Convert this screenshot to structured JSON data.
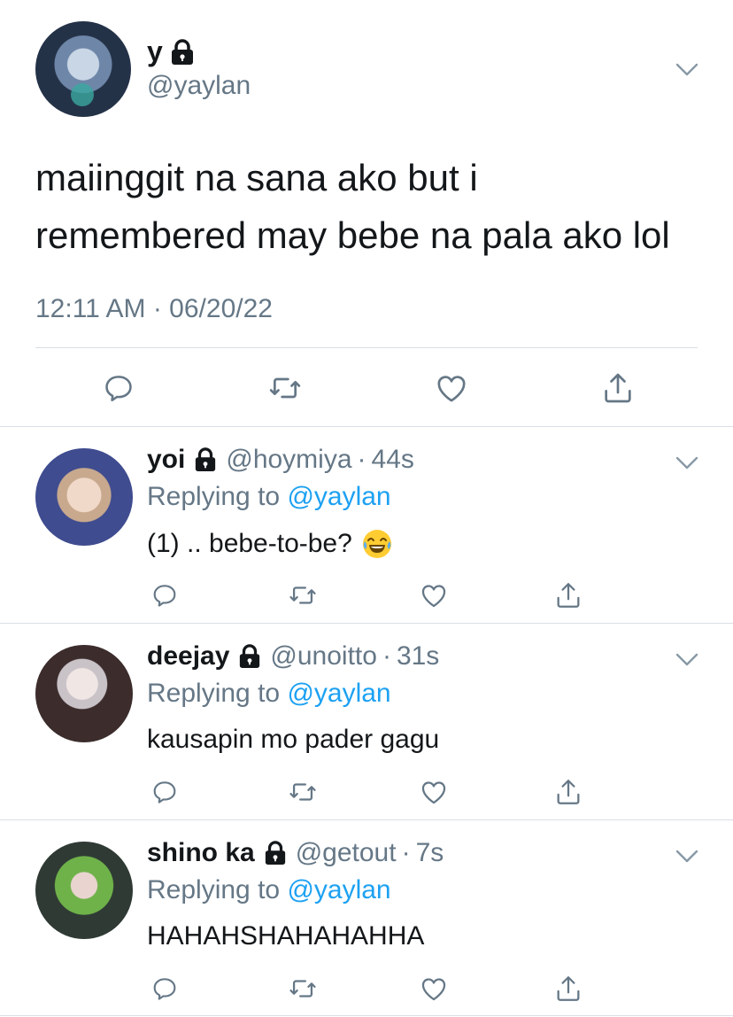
{
  "main_tweet": {
    "display_name": "y",
    "handle": "@yaylan",
    "text_line1": "maiinggit na sana ako but i",
    "text_line2": "remembered may bebe na pala ako lol",
    "timestamp": "12:11 AM · 06/20/22",
    "icons": [
      "lock-icon",
      "chevron-down-icon",
      "reply-icon",
      "retweet-icon",
      "like-icon",
      "share-icon"
    ]
  },
  "replies": [
    {
      "display_name": "yoi",
      "handle": "@hoymiya",
      "dot": "·",
      "time": "44s",
      "replying_prefix": "Replying to",
      "replying_to": "@yaylan",
      "text": "(1) .. bebe-to-be?",
      "emoji": "face-with-tears-of-joy"
    },
    {
      "display_name": "deejay",
      "handle": "@unoitto",
      "dot": "·",
      "time": "31s",
      "replying_prefix": "Replying to",
      "replying_to": "@yaylan",
      "text": "kausapin mo pader gagu"
    },
    {
      "display_name": "shino ka",
      "handle": "@getout",
      "dot": "·",
      "time": "7s",
      "replying_prefix": "Replying to",
      "replying_to": "@yaylan",
      "text": "HAHAHSHAHAHAHHA"
    }
  ],
  "colors": {
    "text": "#14171a",
    "secondary": "#657786",
    "link": "#1da1f2",
    "divider": "#d8dfe5"
  }
}
